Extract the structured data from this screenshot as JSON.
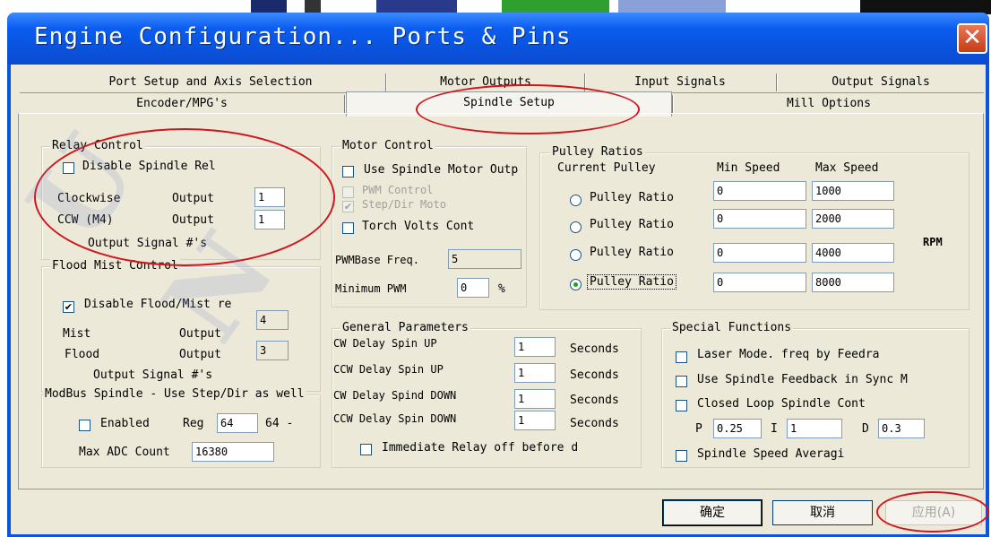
{
  "window": {
    "title": "Engine Configuration... Ports & Pins",
    "close_label": "✕"
  },
  "tabs_row1": [
    "Port Setup and Axis Selection",
    "Motor Outputs",
    "Input Signals",
    "Output Signals"
  ],
  "tabs_row2": [
    "Encoder/MPG's",
    "Spindle Setup",
    "Mill Options"
  ],
  "selected_tab": "Spindle Setup",
  "relay_control": {
    "title": "Relay Control",
    "disable_label": "Disable Spindle Rel",
    "clockwise_label": "Clockwise",
    "ccw_label": "CCW (M4)",
    "output_label": "Output",
    "clockwise_value": "1",
    "ccw_value": "1",
    "footer": "Output Signal #'s"
  },
  "flood_mist": {
    "title": "Flood Mist Control",
    "disable_label": "Disable Flood/Mist re",
    "mist_label": "Mist",
    "flood_label": "Flood",
    "output_label": "Output",
    "mist_value": "4",
    "flood_value": "3",
    "footer": "Output Signal #'s"
  },
  "modbus": {
    "title": "ModBus Spindle - Use Step/Dir as well",
    "enabled_label": "Enabled",
    "reg_label": "Reg",
    "reg_value": "64",
    "reg_suffix": "64 -",
    "max_adc_label": "Max ADC Count",
    "max_adc_value": "16380"
  },
  "motor_control": {
    "title": "Motor Control",
    "use_spindle_label": "Use Spindle Motor Outp",
    "pwm_control_label": "PWM Control",
    "step_dir_label": "Step/Dir Moto",
    "torch_label": "Torch Volts Cont",
    "pwm_base_label": "PWMBase Freq.",
    "pwm_base_value": "5",
    "min_pwm_label": "Minimum PWM",
    "min_pwm_value": "0",
    "percent": "%"
  },
  "pulley": {
    "title": "Pulley Ratios",
    "current_label": "Current Pulley",
    "min_label": "Min Speed",
    "max_label": "Max Speed",
    "rpm_label": "RPM",
    "rows": [
      {
        "label": "Pulley Ratio",
        "min": "0",
        "max": "1000"
      },
      {
        "label": "Pulley Ratio",
        "min": "0",
        "max": "2000"
      },
      {
        "label": "Pulley Ratio",
        "min": "0",
        "max": "4000"
      },
      {
        "label": "Pulley Ratio",
        "min": "0",
        "max": "8000"
      }
    ]
  },
  "general": {
    "title": "General Parameters",
    "seconds": "Seconds",
    "rows": [
      {
        "label": "CW Delay Spin UP",
        "value": "1"
      },
      {
        "label": "CCW Delay Spin UP",
        "value": "1"
      },
      {
        "label": "CW Delay Spind DOWN",
        "value": "1"
      },
      {
        "label": "CCW Delay Spin DOWN",
        "value": "1"
      }
    ],
    "immediate_label": "Immediate Relay off before d"
  },
  "special": {
    "title": "Special Functions",
    "laser_label": "Laser Mode. freq by Feedra",
    "feedback_label": "Use Spindle Feedback in Sync M",
    "closed_loop_label": "Closed Loop Spindle Cont",
    "p_label": "P",
    "p_value": "0.25",
    "i_label": "I",
    "i_value": "1",
    "d_label": "D",
    "d_value": "0.3",
    "averaging_label": "Spindle Speed Averagi"
  },
  "buttons": {
    "ok": "确定",
    "cancel": "取消",
    "apply": "应用(A)"
  },
  "colors": {
    "titlebar": "#0a55e0",
    "dialog": "#ece9d8",
    "annotation": "#d0141c"
  }
}
